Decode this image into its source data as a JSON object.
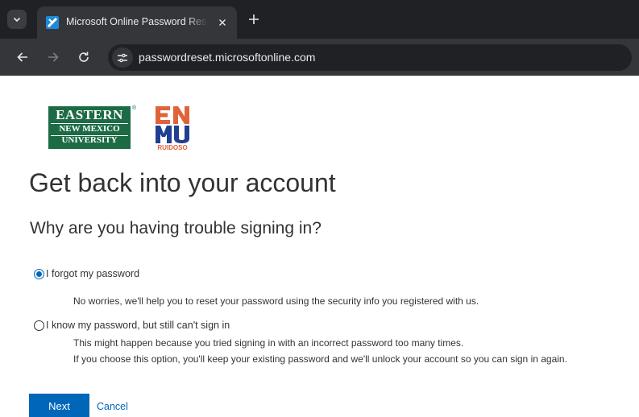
{
  "browser": {
    "tab_title": "Microsoft Online Password Reset",
    "tab_favicon": "microsoft-password-reset-icon",
    "url": "passwordreset.microsoftonline.com"
  },
  "logos": {
    "enmu_line1": "EASTERN",
    "enmu_line2": "NEW MEXICO",
    "enmu_line3": "UNIVERSITY",
    "enmu_trademark": "®",
    "ruidoso_label": "RUIDOSO"
  },
  "page": {
    "title": "Get back into your account",
    "subtitle": "Why are you having trouble signing in?"
  },
  "options": [
    {
      "label": "I forgot my password",
      "selected": true,
      "description": [
        "No worries, we'll help you to reset your password using the security info you registered with us."
      ]
    },
    {
      "label": "I know my password, but still can't sign in",
      "selected": false,
      "description": [
        "This might happen because you tried signing in with an incorrect password too many times.",
        "If you choose this option, you'll keep your existing password and we'll unlock your account so you can sign in again."
      ]
    }
  ],
  "actions": {
    "next_label": "Next",
    "cancel_label": "Cancel"
  },
  "colors": {
    "accent": "#0067b8",
    "enmu_green": "#1d6b45",
    "ruidoso_orange": "#e0633a",
    "ruidoso_blue": "#1f3f93"
  }
}
